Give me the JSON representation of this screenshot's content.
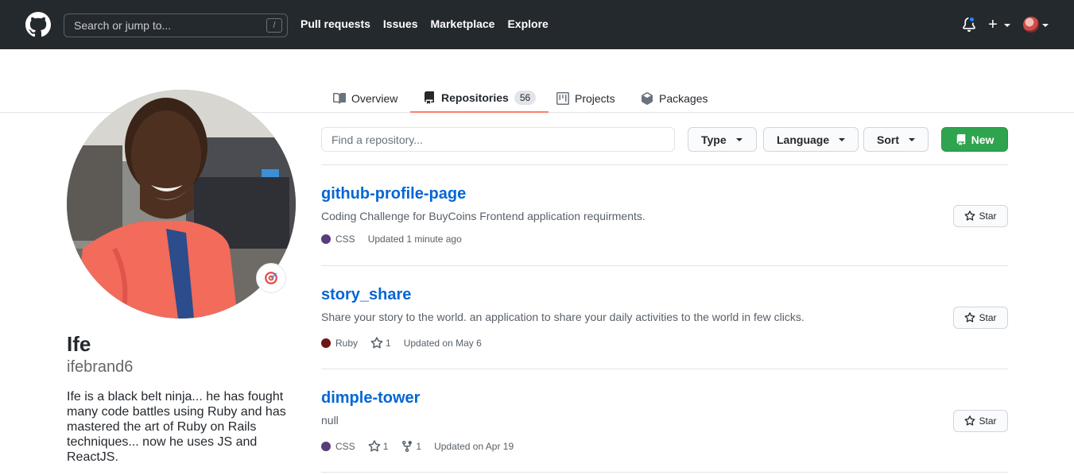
{
  "header": {
    "search_placeholder": "Search or jump to...",
    "slash_key": "/",
    "nav": [
      "Pull requests",
      "Issues",
      "Marketplace",
      "Explore"
    ],
    "plus_label": "+"
  },
  "tabs": [
    {
      "label": "Overview",
      "icon": "book-icon"
    },
    {
      "label": "Repositories",
      "icon": "repo-icon",
      "count": "56",
      "active": true
    },
    {
      "label": "Projects",
      "icon": "project-icon"
    },
    {
      "label": "Packages",
      "icon": "package-icon"
    }
  ],
  "profile": {
    "name": "Ife",
    "login": "ifebrand6",
    "bio": "Ife is a black belt ninja... he has fought many code battles using Ruby and has mastered the art of Ruby on Rails techniques... now he uses JS and ReactJS."
  },
  "filters": {
    "find_placeholder": "Find a repository...",
    "type_label": "Type",
    "language_label": "Language",
    "sort_label": "Sort",
    "new_label": "New"
  },
  "repos": [
    {
      "name": "github-profile-page",
      "description": "Coding Challenge for BuyCoins Frontend application requirments.",
      "language": "CSS",
      "language_color": "#563d7c",
      "updated": "Updated 1 minute ago",
      "star_label": "Star"
    },
    {
      "name": "story_share",
      "description": "Share your story to the world. an application to share your daily activities to the world in few clicks.",
      "language": "Ruby",
      "language_color": "#701516",
      "stars": "1",
      "updated": "Updated on May 6",
      "star_label": "Star"
    },
    {
      "name": "dimple-tower",
      "description": "null",
      "language": "CSS",
      "language_color": "#563d7c",
      "stars": "1",
      "forks": "1",
      "updated": "Updated on Apr 19",
      "star_label": "Star"
    }
  ]
}
